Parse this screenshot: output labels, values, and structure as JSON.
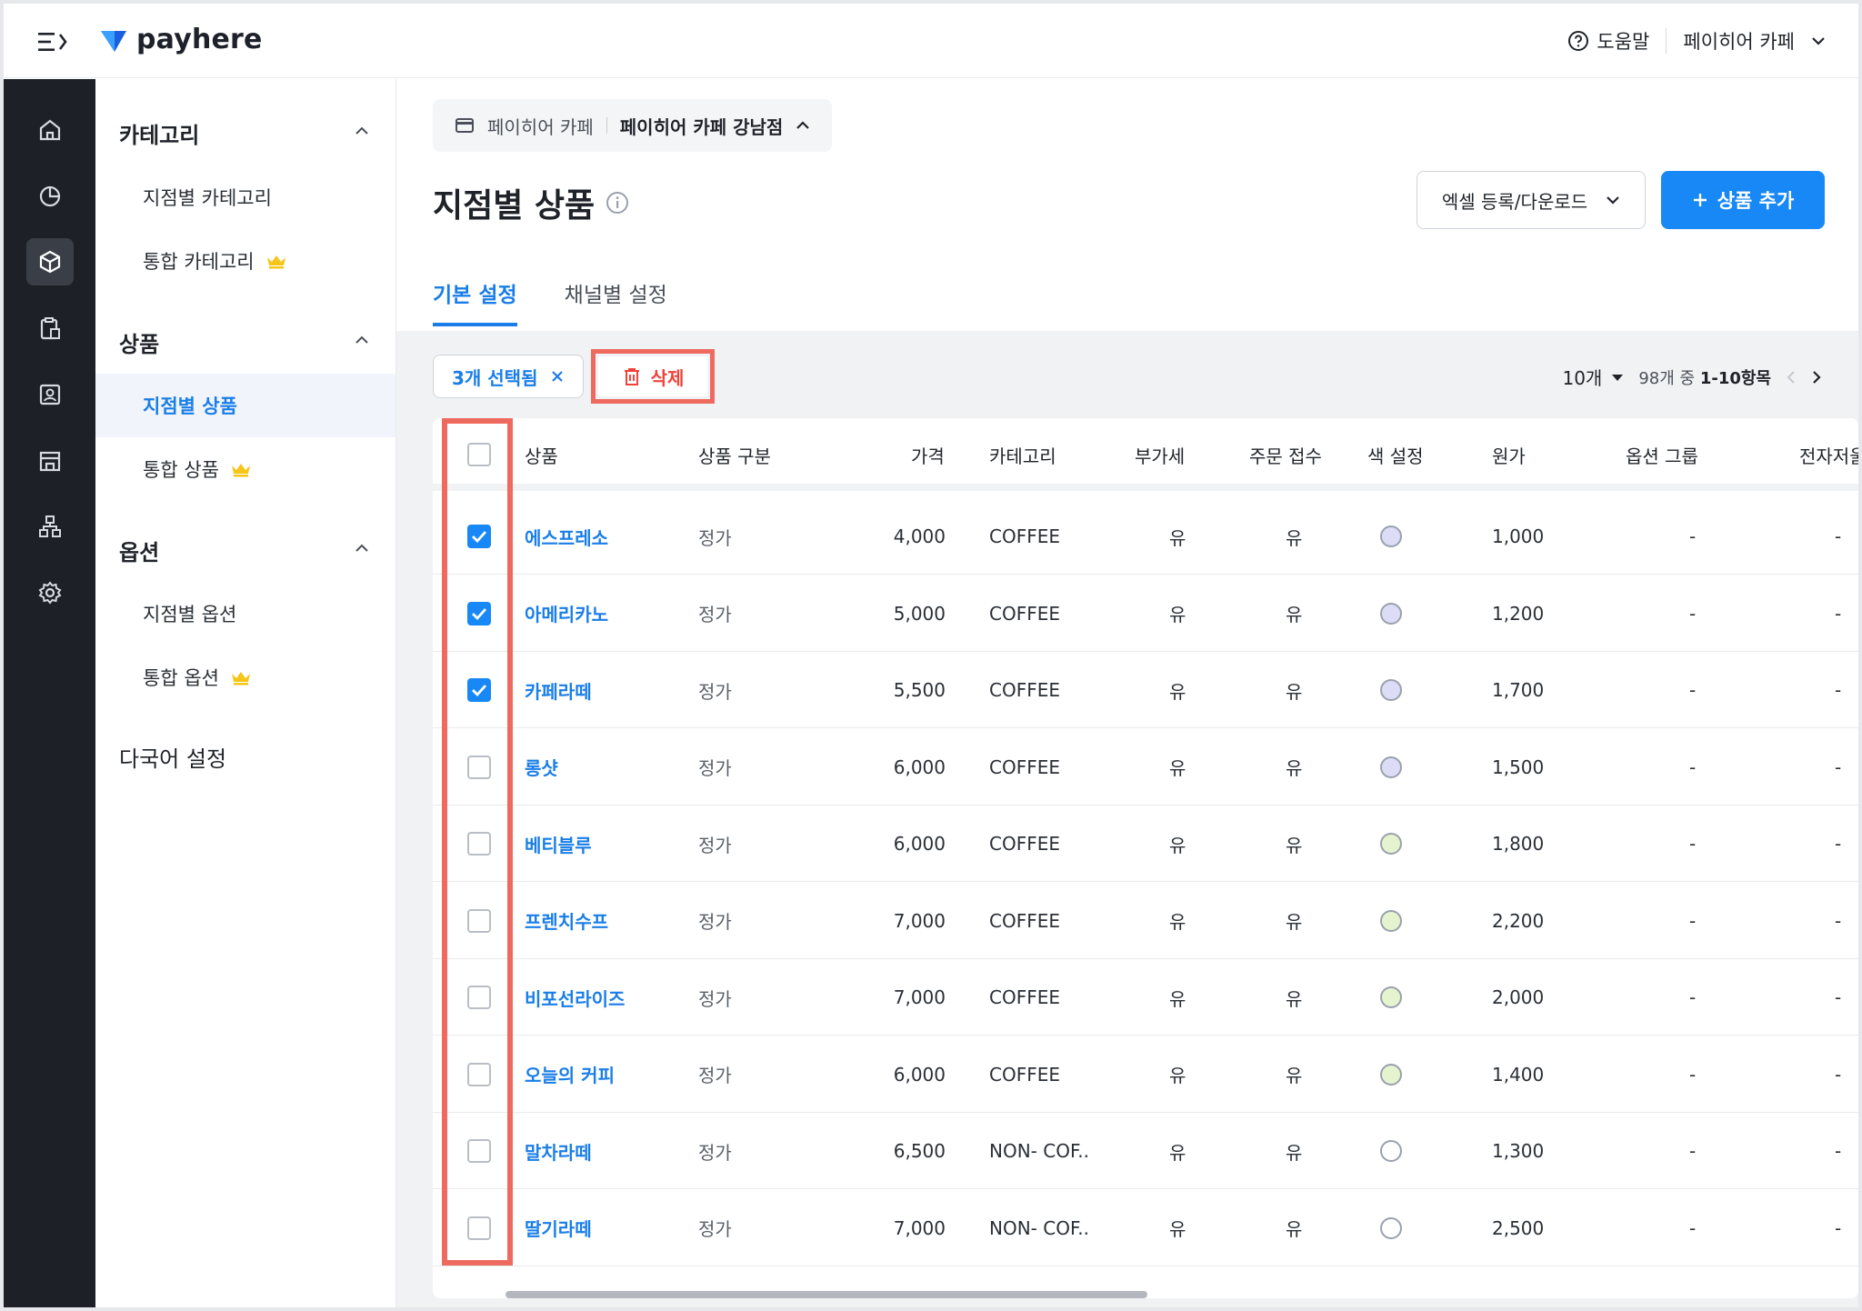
{
  "header": {
    "brand": "payhere",
    "help_label": "도움말",
    "store_name": "페이히어 카페"
  },
  "rail": {
    "items": [
      "home-icon",
      "chart-icon",
      "box-icon",
      "clipboard-icon",
      "contact-icon",
      "store-icon",
      "org-icon",
      "gear-icon"
    ],
    "active_index": 2
  },
  "sidebar": {
    "groups": [
      {
        "title": "카테고리",
        "items": [
          {
            "label": "지점별 카테고리",
            "premium": false
          },
          {
            "label": "통합 카테고리",
            "premium": true
          }
        ]
      },
      {
        "title": "상품",
        "items": [
          {
            "label": "지점별 상품",
            "premium": false,
            "active": true
          },
          {
            "label": "통합 상품",
            "premium": true
          }
        ]
      },
      {
        "title": "옵션",
        "items": [
          {
            "label": "지점별 옵션",
            "premium": false
          },
          {
            "label": "통합 옵션",
            "premium": true
          }
        ]
      },
      {
        "title": "다국어 설정",
        "items": []
      }
    ]
  },
  "breadcrumb": {
    "parent": "페이히어 카페",
    "current": "페이히어 카페 강남점"
  },
  "page": {
    "title": "지점별 상품",
    "excel_button": "엑셀 등록/다운로드",
    "add_button": "상품 추가"
  },
  "tabs": [
    {
      "label": "기본 설정",
      "active": true
    },
    {
      "label": "채널별 설정",
      "active": false
    }
  ],
  "toolbar": {
    "selected_label": "3개 선택됨",
    "delete_label": "삭제",
    "page_size": "10개",
    "range_prefix": "98개 중",
    "range": "1-10항목"
  },
  "table": {
    "headers": [
      "상품",
      "상품 구분",
      "가격",
      "카테고리",
      "부가세",
      "주문 접수",
      "색 설정",
      "원가",
      "옵션 그룹",
      "전자저울"
    ],
    "rows": [
      {
        "checked": true,
        "name": "에스프레소",
        "type": "정가",
        "price": "4,000",
        "category": "COFFEE",
        "vat": "유",
        "order": "유",
        "color": "#dcdcf6",
        "cost": "1,000",
        "option": "-",
        "scale": "-"
      },
      {
        "checked": true,
        "name": "아메리카노",
        "type": "정가",
        "price": "5,000",
        "category": "COFFEE",
        "vat": "유",
        "order": "유",
        "color": "#dcdcf6",
        "cost": "1,200",
        "option": "-",
        "scale": "-"
      },
      {
        "checked": true,
        "name": "카페라떼",
        "type": "정가",
        "price": "5,500",
        "category": "COFFEE",
        "vat": "유",
        "order": "유",
        "color": "#dcdcf6",
        "cost": "1,700",
        "option": "-",
        "scale": "-"
      },
      {
        "checked": false,
        "name": "롱샷",
        "type": "정가",
        "price": "6,000",
        "category": "COFFEE",
        "vat": "유",
        "order": "유",
        "color": "#dcdcf6",
        "cost": "1,500",
        "option": "-",
        "scale": "-"
      },
      {
        "checked": false,
        "name": "베티블루",
        "type": "정가",
        "price": "6,000",
        "category": "COFFEE",
        "vat": "유",
        "order": "유",
        "color": "#e6f3cf",
        "cost": "1,800",
        "option": "-",
        "scale": "-"
      },
      {
        "checked": false,
        "name": "프렌치수프",
        "type": "정가",
        "price": "7,000",
        "category": "COFFEE",
        "vat": "유",
        "order": "유",
        "color": "#e6f3cf",
        "cost": "2,200",
        "option": "-",
        "scale": "-"
      },
      {
        "checked": false,
        "name": "비포선라이즈",
        "type": "정가",
        "price": "7,000",
        "category": "COFFEE",
        "vat": "유",
        "order": "유",
        "color": "#e6f3cf",
        "cost": "2,000",
        "option": "-",
        "scale": "-"
      },
      {
        "checked": false,
        "name": "오늘의 커피",
        "type": "정가",
        "price": "6,000",
        "category": "COFFEE",
        "vat": "유",
        "order": "유",
        "color": "#e6f3cf",
        "cost": "1,400",
        "option": "-",
        "scale": "-"
      },
      {
        "checked": false,
        "name": "말차라떼",
        "type": "정가",
        "price": "6,500",
        "category": "NON- COF..",
        "vat": "유",
        "order": "유",
        "color": "#ffffff",
        "cost": "1,300",
        "option": "-",
        "scale": "-"
      },
      {
        "checked": false,
        "name": "딸기라떼",
        "type": "정가",
        "price": "7,000",
        "category": "NON- COF..",
        "vat": "유",
        "order": "유",
        "color": "#ffffff",
        "cost": "2,500",
        "option": "-",
        "scale": "-"
      }
    ]
  },
  "colors": {
    "accent": "#1788f5",
    "danger": "#f0433a",
    "highlight": "#ee6a5f",
    "rail_bg": "#1d2127",
    "premium": "#f5c518"
  }
}
